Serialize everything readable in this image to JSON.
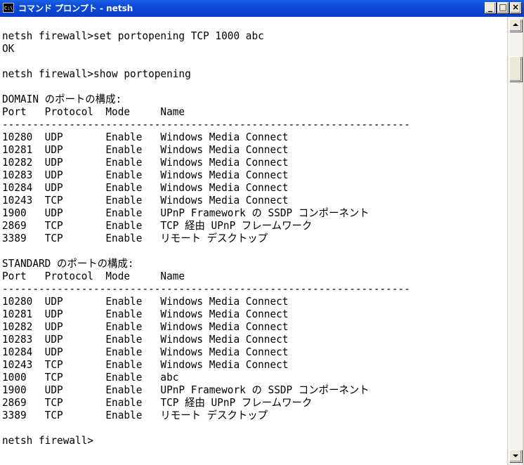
{
  "window": {
    "title": "コマンド プロンプト - netsh",
    "icon_label": "C:\\",
    "minimize_label": "_",
    "maximize_label": "□",
    "close_label": "×"
  },
  "console": {
    "lines": [
      "netsh firewall>set portopening TCP 1000 abc",
      "OK",
      "",
      "netsh firewall>show portopening",
      "",
      "DOMAIN のポートの構成:",
      "Port   Protocol  Mode     Name",
      "-------------------------------------------------------------------",
      "10280  UDP       Enable   Windows Media Connect",
      "10281  UDP       Enable   Windows Media Connect",
      "10282  UDP       Enable   Windows Media Connect",
      "10283  UDP       Enable   Windows Media Connect",
      "10284  UDP       Enable   Windows Media Connect",
      "10243  TCP       Enable   Windows Media Connect",
      "1900   UDP       Enable   UPnP Framework の SSDP コンポーネント",
      "2869   TCP       Enable   TCP 経由 UPnP フレームワーク",
      "3389   TCP       Enable   リモート デスクトップ",
      "",
      "STANDARD のポートの構成:",
      "Port   Protocol  Mode     Name",
      "-------------------------------------------------------------------",
      "10280  UDP       Enable   Windows Media Connect",
      "10281  UDP       Enable   Windows Media Connect",
      "10282  UDP       Enable   Windows Media Connect",
      "10283  UDP       Enable   Windows Media Connect",
      "10284  UDP       Enable   Windows Media Connect",
      "10243  TCP       Enable   Windows Media Connect",
      "1000   TCP       Enable   abc",
      "1900   UDP       Enable   UPnP Framework の SSDP コンポーネント",
      "2869   TCP       Enable   TCP 経由 UPnP フレームワーク",
      "3389   TCP       Enable   リモート デスクトップ",
      "",
      "netsh firewall>"
    ]
  },
  "colors": {
    "titlebar": "#0a4ad6",
    "console_background": "#ffffff",
    "console_text": "#000000"
  }
}
